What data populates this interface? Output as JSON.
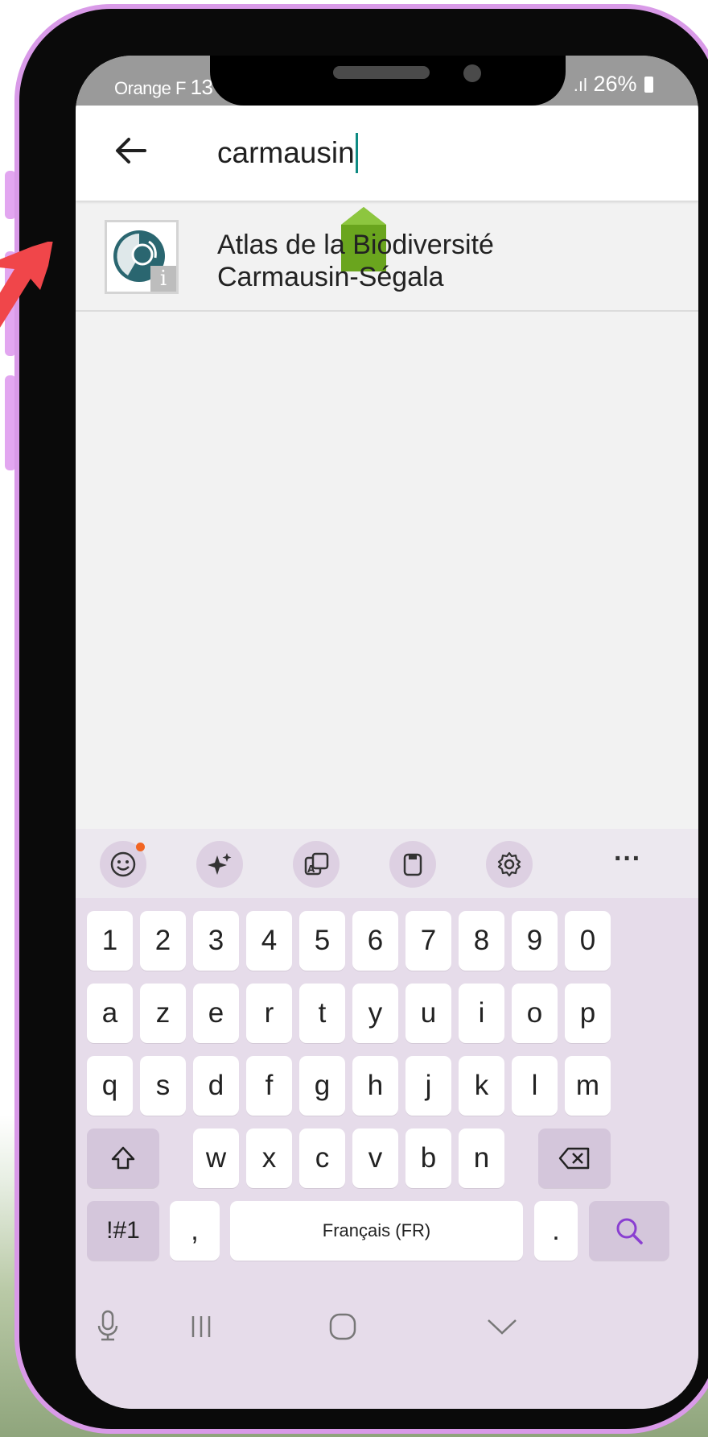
{
  "status_bar": {
    "carrier": "Orange F",
    "time_partial": "13",
    "signal": ".ıl",
    "battery": "26%"
  },
  "search": {
    "query": "carmausin"
  },
  "results": [
    {
      "title_line1": "Atlas de la Biodiversité",
      "title_line2": "Carmausin-Ségala"
    }
  ],
  "keyboard": {
    "toolbar": [
      "emoji-icon",
      "ai-sparkle-icon",
      "translate-icon",
      "clipboard-icon",
      "settings-gear-icon",
      "more-icon"
    ],
    "more_label": "···",
    "row_numbers": [
      "1",
      "2",
      "3",
      "4",
      "5",
      "6",
      "7",
      "8",
      "9",
      "0"
    ],
    "row_1": [
      "a",
      "z",
      "e",
      "r",
      "t",
      "y",
      "u",
      "i",
      "o",
      "p"
    ],
    "row_2": [
      "q",
      "s",
      "d",
      "f",
      "g",
      "h",
      "j",
      "k",
      "l",
      "m"
    ],
    "row_3": [
      "w",
      "x",
      "c",
      "v",
      "b",
      "n"
    ],
    "symbols_label": "!#1",
    "comma": ",",
    "space_label": "Français (FR)",
    "period": ".",
    "accent_color": "#8a3fd1"
  },
  "colors": {
    "frame": "#d99ae8",
    "caret": "#0e8a82",
    "handle": "#6aa51e",
    "pointer": "#f0464a"
  }
}
